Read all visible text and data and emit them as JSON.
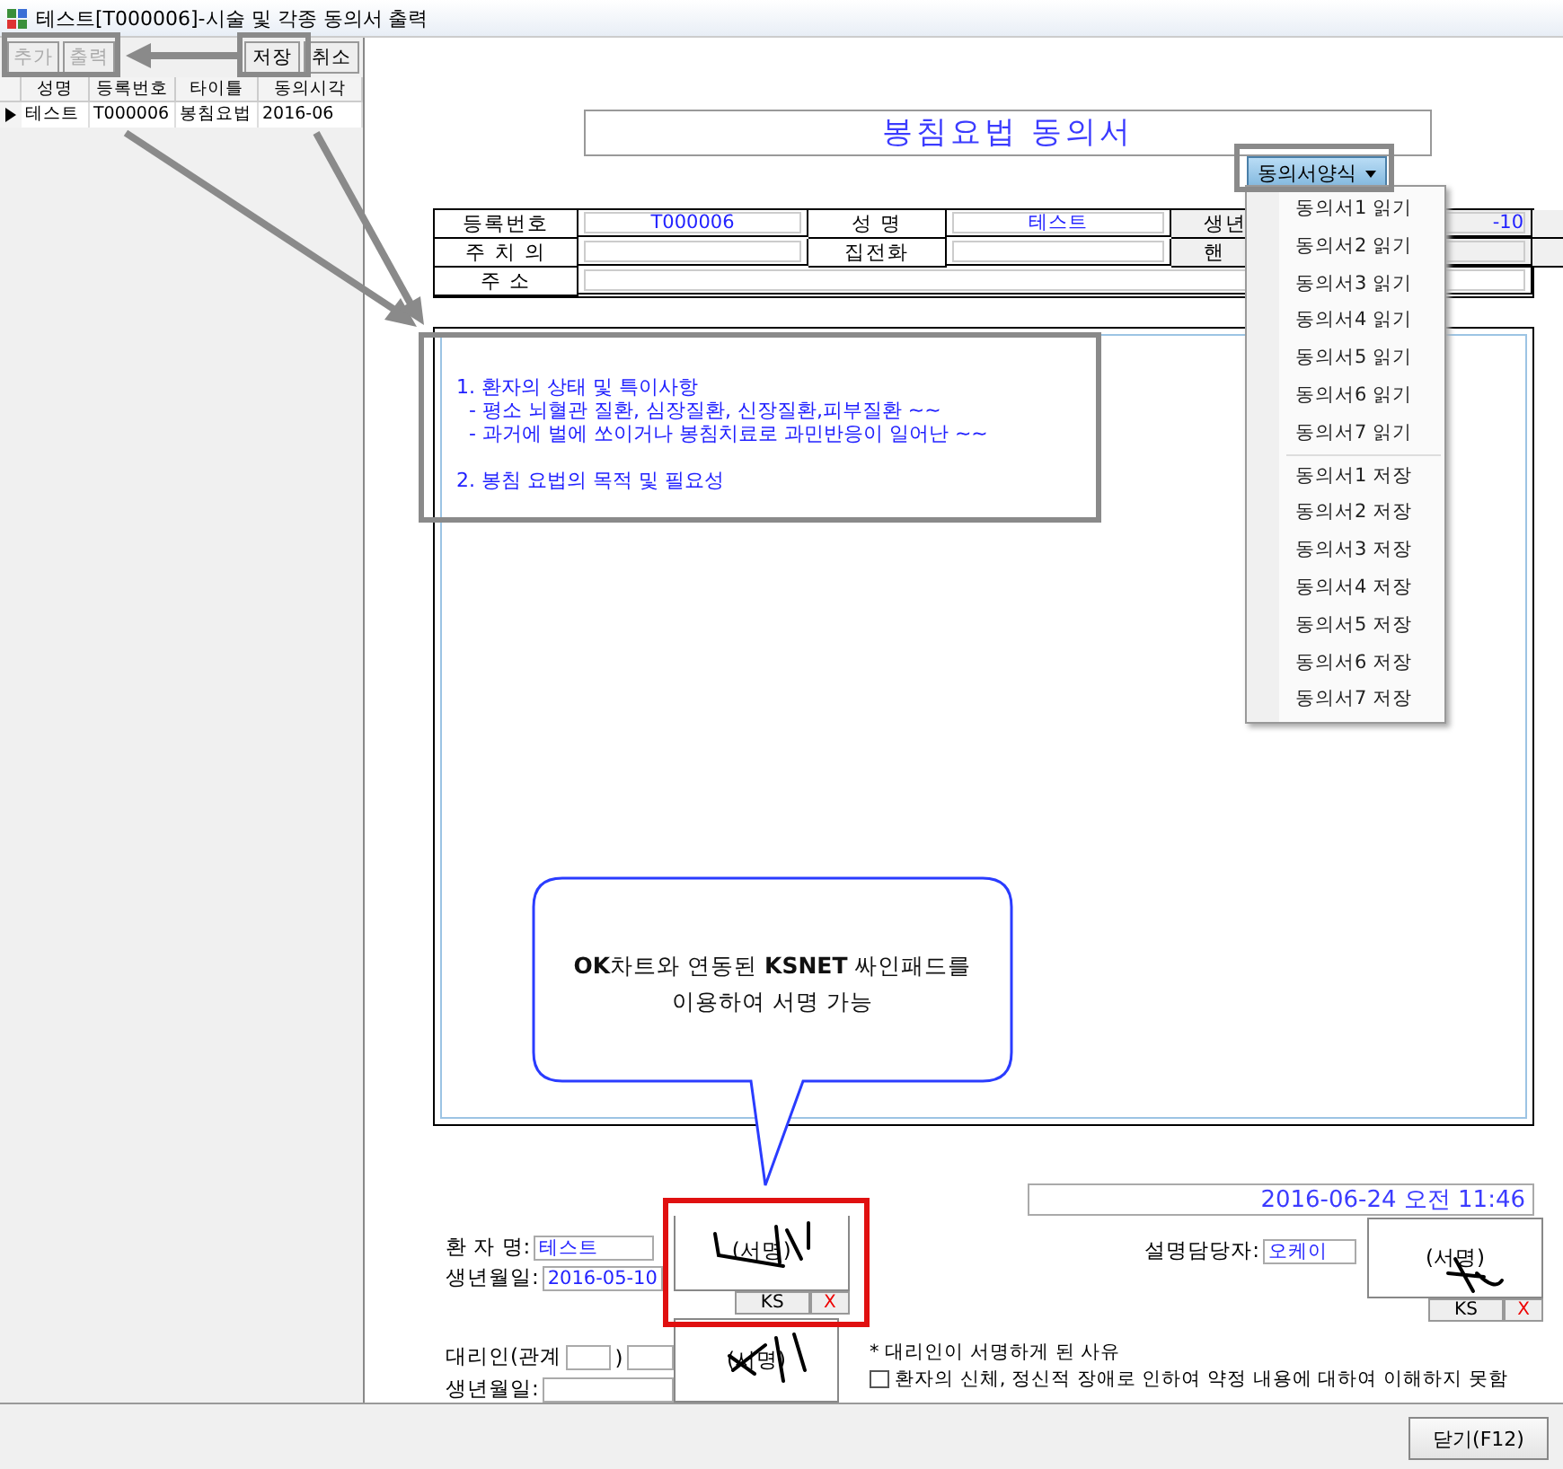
{
  "window": {
    "title": "테스트[T000006]-시술 및 각종 동의서 출력"
  },
  "toolbar": [
    {
      "label": "추가",
      "disabled": true
    },
    {
      "label": "출력",
      "disabled": true
    },
    {
      "label": "저장",
      "disabled": false
    },
    {
      "label": "취소",
      "disabled": false
    }
  ],
  "grid": {
    "columns": [
      "성명",
      "등록번호",
      "타이틀",
      "동의시각"
    ],
    "rows": [
      {
        "cells": [
          "테스트",
          "T000006",
          "봉침요법",
          "2016-06"
        ],
        "selected": true
      }
    ]
  },
  "form": {
    "title": "봉침요법 동의서",
    "template_button": "동의서양식",
    "template_menu": {
      "read_items": [
        "동의서1 읽기",
        "동의서2 읽기",
        "동의서3 읽기",
        "동의서4 읽기",
        "동의서5 읽기",
        "동의서6 읽기",
        "동의서7 읽기"
      ],
      "save_items": [
        "동의서1 저장",
        "동의서2 저장",
        "동의서3 저장",
        "동의서4 저장",
        "동의서5 저장",
        "동의서6 저장",
        "동의서7 저장"
      ]
    },
    "info_rows": [
      {
        "cells": [
          {
            "label": "등록번호",
            "value": "T000006"
          },
          {
            "label": "성 명",
            "value": "테스트"
          },
          {
            "label": "생년",
            "value": "-10"
          }
        ]
      },
      {
        "cells": [
          {
            "label": "주 치 의"
          },
          {
            "label": "집전화"
          },
          {
            "label": "핸"
          }
        ]
      },
      {
        "cells": [
          {
            "label": "주 소"
          }
        ]
      }
    ],
    "content_sections": [
      {
        "lines": [
          "1. 환자의 상태 및 특이사항",
          "  - 평소 뇌혈관 질환, 심장질환, 신장질환,피부질환 ~~",
          "  - 과거에 벌에 쏘이거나 봉침치료로 과민반응이 일어난 ~~"
        ]
      },
      {
        "lines": [
          "2. 봉침 요법의 목적 및 필요성"
        ]
      }
    ],
    "timestamp": "2016-06-24 오전 11:46",
    "patient": {
      "name_label": "환 자 명:",
      "name": "테스트",
      "birth_label": "생년월일:",
      "birth": "2016-05-10",
      "sign_placeholder": "(서명)",
      "ks_button": "KS",
      "clear_button": "X"
    },
    "staff": {
      "label": "설명담당자:",
      "name": "오케이",
      "sign_placeholder": "(서명)",
      "ks_button": "KS",
      "clear_button": "X"
    },
    "proxy": {
      "relation_label": "대리인(관계",
      "relation_close": ")",
      "birth_label": "생년월일:",
      "sign_placeholder": "(서명)"
    },
    "proxy_reason": {
      "title": "* 대리인이 서명하게 된 사유",
      "options": [
        {
          "label": "환자의 신체, 정신적 장애로 인하여 약정 내용에 대하여 이해하지 못함",
          "checked": false
        }
      ]
    }
  },
  "callout": {
    "text": "**OK**차트와 연동된 **KSNET** 싸인패드를\n이용하여 서명 가능"
  },
  "close_button": "닫기(F12)"
}
